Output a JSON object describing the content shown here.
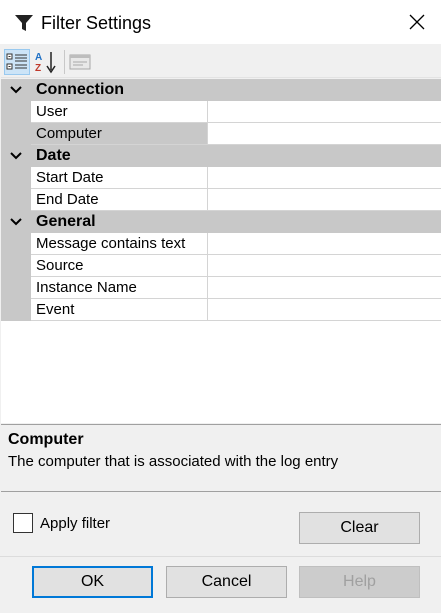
{
  "window": {
    "title": "Filter Settings"
  },
  "toolbar": {
    "buttons": [
      {
        "name": "categorized-view-icon",
        "active": true
      },
      {
        "name": "alphabetical-sort-icon",
        "active": false
      },
      {
        "name": "property-pages-icon",
        "active": false,
        "disabled": true
      }
    ]
  },
  "grid": {
    "categories": [
      {
        "label": "Connection",
        "properties": [
          {
            "name": "User",
            "value": ""
          },
          {
            "name": "Computer",
            "value": "",
            "selected": true
          }
        ]
      },
      {
        "label": "Date",
        "properties": [
          {
            "name": "Start Date",
            "value": ""
          },
          {
            "name": "End Date",
            "value": ""
          }
        ]
      },
      {
        "label": "General",
        "properties": [
          {
            "name": "Message contains text",
            "value": ""
          },
          {
            "name": "Source",
            "value": ""
          },
          {
            "name": "Instance Name",
            "value": ""
          },
          {
            "name": "Event",
            "value": ""
          }
        ]
      }
    ]
  },
  "description": {
    "title": "Computer",
    "text": "The computer that is associated with the log entry"
  },
  "filter": {
    "apply_label": "Apply filter",
    "checked": false,
    "clear_label": "Clear"
  },
  "footer": {
    "ok_label": "OK",
    "cancel_label": "Cancel",
    "help_label": "Help"
  },
  "colors": {
    "accent": "#0078d7",
    "category_bg": "#c8c8c8",
    "frame_bg": "#f0f0f0"
  }
}
